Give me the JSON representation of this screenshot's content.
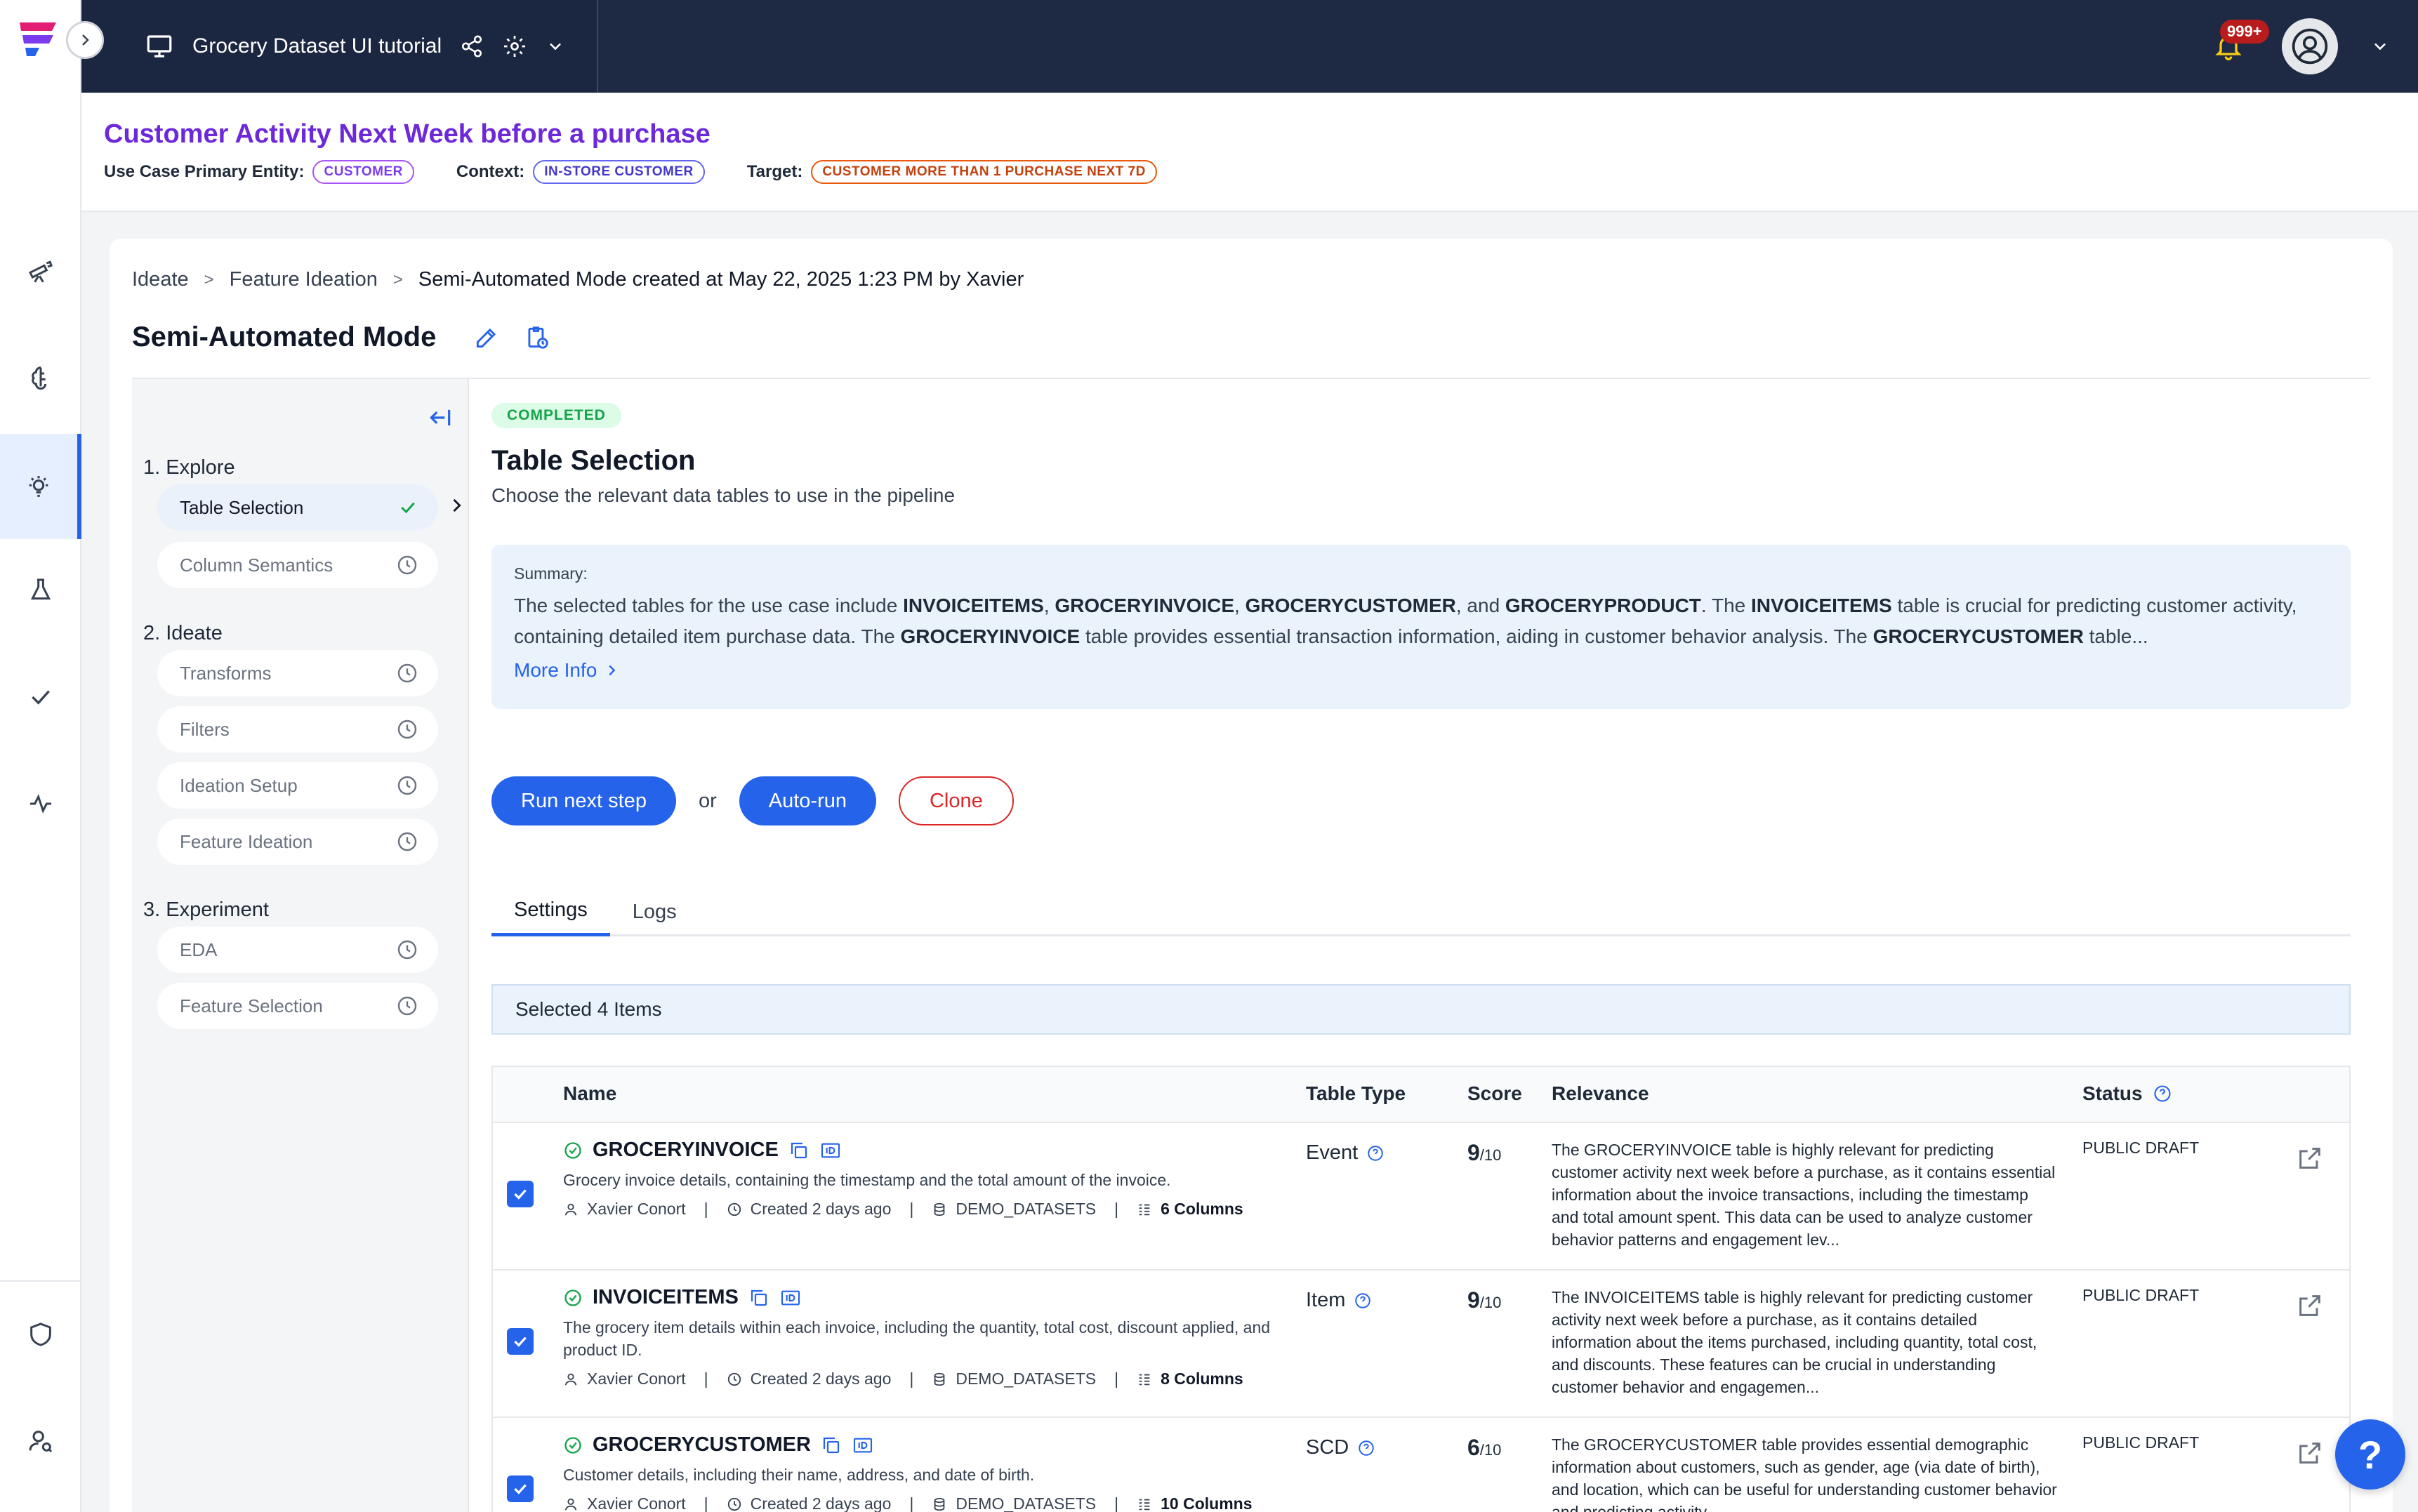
{
  "topbar": {
    "project_title": "Grocery Dataset UI tutorial",
    "notification_count": "999+"
  },
  "usecase": {
    "title": "Customer Activity Next Week before a purchase",
    "primary_entity_label": "Use Case Primary Entity:",
    "primary_entity": "CUSTOMER",
    "context_label": "Context:",
    "context": "IN-STORE CUSTOMER",
    "target_label": "Target:",
    "target": "CUSTOMER MORE THAN 1 PURCHASE NEXT 7D"
  },
  "breadcrumb": {
    "items": [
      "Ideate",
      "Feature Ideation"
    ],
    "current": "Semi-Automated Mode created at May 22, 2025 1:23 PM by Xavier",
    "sep": ">"
  },
  "page": {
    "title": "Semi-Automated Mode"
  },
  "steps": {
    "groups": [
      {
        "label": "1. Explore",
        "items": [
          "Table Selection",
          "Column Semantics"
        ]
      },
      {
        "label": "2. Ideate",
        "items": [
          "Transforms",
          "Filters",
          "Ideation Setup",
          "Feature Ideation"
        ]
      },
      {
        "label": "3. Experiment",
        "items": [
          "EDA",
          "Feature Selection"
        ]
      }
    ]
  },
  "detail": {
    "status": "COMPLETED",
    "title": "Table Selection",
    "subtitle": "Choose the relevant data tables to use in the pipeline",
    "summary_label": "Summary:",
    "summary_parts": [
      "The selected tables for the use case include ",
      "INVOICEITEMS",
      ", ",
      "GROCERYINVOICE",
      ", ",
      "GROCERYCUSTOMER",
      ", and ",
      "GROCERYPRODUCT",
      ". The ",
      "INVOICEITEMS",
      " table is crucial for predicting customer activity, containing detailed item purchase data. The ",
      "GROCERYINVOICE",
      " table provides essential transaction information, aiding in customer behavior analysis. The ",
      "GROCERYCUSTOMER",
      " table..."
    ],
    "more_info": "More Info",
    "run_next": "Run next step",
    "or": "or",
    "auto_run": "Auto-run",
    "clone": "Clone",
    "tabs": [
      "Settings",
      "Logs"
    ],
    "selected_text": "Selected 4 Items"
  },
  "table": {
    "headers": {
      "name": "Name",
      "type": "Table Type",
      "score": "Score",
      "relevance": "Relevance",
      "status": "Status"
    },
    "rows": [
      {
        "name": "GROCERYINVOICE",
        "description": "Grocery invoice details, containing the timestamp and the total amount of the invoice.",
        "owner": "Xavier Conort",
        "created": "Created 2 days ago",
        "source": "DEMO_DATASETS",
        "columns": "6 Columns",
        "type": "Event",
        "score": "9",
        "score_max": "/10",
        "relevance": "The GROCERYINVOICE table is highly relevant for predicting customer activity next week before a purchase, as it contains essential information about the invoice transactions, including the timestamp and total amount spent. This data can be used to analyze customer behavior patterns and engagement lev...",
        "status": "PUBLIC DRAFT"
      },
      {
        "name": "INVOICEITEMS",
        "description": "The grocery item details within each invoice, including the quantity, total cost, discount applied, and product ID.",
        "owner": "Xavier Conort",
        "created": "Created 2 days ago",
        "source": "DEMO_DATASETS",
        "columns": "8 Columns",
        "type": "Item",
        "score": "9",
        "score_max": "/10",
        "relevance": "The INVOICEITEMS table is highly relevant for predicting customer activity next week before a purchase, as it contains detailed information about the items purchased, including quantity, total cost, and discounts. These features can be crucial in understanding customer behavior and engagemen...",
        "status": "PUBLIC DRAFT"
      },
      {
        "name": "GROCERYCUSTOMER",
        "description": "Customer details, including their name, address, and date of birth.",
        "owner": "Xavier Conort",
        "created": "Created 2 days ago",
        "source": "DEMO_DATASETS",
        "columns": "10 Columns",
        "type": "SCD",
        "score": "6",
        "score_max": "/10",
        "relevance": "The GROCERYCUSTOMER table provides essential demographic information about customers, such as gender, age (via date of birth), and location, which can be useful for understanding customer behavior and predicting activity...",
        "status": "PUBLIC DRAFT"
      }
    ]
  },
  "help": {
    "label": "?"
  }
}
